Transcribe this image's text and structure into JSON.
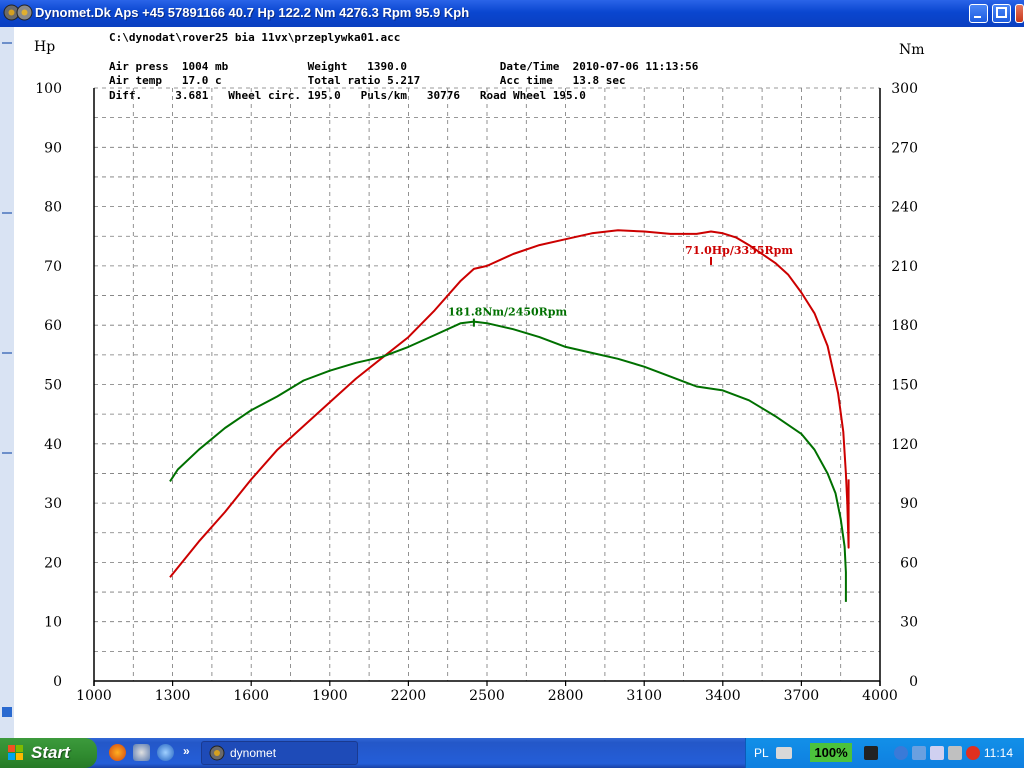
{
  "window": {
    "title": "Dynomet.Dk Aps +45 57891166  40.7 Hp 122.2 Nm 4276.3 Rpm 95.9 Kph"
  },
  "header": {
    "file_path": "C:\\dynodat\\rover25 bia 11vx\\przeplywka01.acc",
    "row1": "Air press  1004 mb            Weight   1390.0              Date/Time  2010-07-06 11:13:56",
    "row2": "Air temp   17.0 c             Total ratio 5.217            Acc time   13.8 sec",
    "row3": "Diff.     3.681   Wheel circ. 195.0   Puls/km   30776   Road Wheel 195.0"
  },
  "chart_data": {
    "type": "line",
    "x_label": "",
    "xlim": [
      1000,
      4000
    ],
    "x_ticks": [
      "1000",
      "1300",
      "1600",
      "1900",
      "2200",
      "2500",
      "2800",
      "3100",
      "3400",
      "3700",
      "4000"
    ],
    "y_left": {
      "label": "Hp",
      "range": [
        0,
        100
      ],
      "ticks": [
        "0",
        "10",
        "20",
        "30",
        "40",
        "50",
        "60",
        "70",
        "80",
        "90",
        "100"
      ]
    },
    "y_right": {
      "label": "Nm",
      "range": [
        0,
        300
      ],
      "ticks": [
        "0",
        "30",
        "60",
        "90",
        "120",
        "150",
        "180",
        "210",
        "240",
        "270",
        "300"
      ]
    },
    "grid": true,
    "series": [
      {
        "axis": "left",
        "color": "#cc0000",
        "unit": "Hp",
        "x": [
          1290,
          1400,
          1500,
          1600,
          1700,
          1800,
          1900,
          2000,
          2100,
          2200,
          2300,
          2400,
          2450,
          2500,
          2600,
          2700,
          2800,
          2900,
          3000,
          3100,
          3200,
          3300,
          3355,
          3400,
          3450,
          3500,
          3600,
          3650,
          3700,
          3750,
          3800,
          3840,
          3860,
          3870,
          3875,
          3880,
          3880,
          3880
        ],
        "values": [
          17.5,
          23.5,
          28.5,
          34,
          39,
          43,
          47,
          51,
          54.5,
          58,
          62.5,
          67.5,
          69.5,
          70,
          72,
          73.5,
          74.5,
          75.5,
          76,
          75.8,
          75.4,
          75.4,
          75.8,
          75.5,
          74.8,
          73.5,
          70.5,
          68.5,
          65.5,
          62,
          56.5,
          48.5,
          42,
          35,
          30,
          22.5,
          26,
          34
        ]
      },
      {
        "axis": "right",
        "color": "#007000",
        "unit": "Nm",
        "x": [
          1290,
          1320,
          1400,
          1500,
          1600,
          1700,
          1800,
          1900,
          2000,
          2100,
          2200,
          2300,
          2400,
          2450,
          2500,
          2600,
          2700,
          2800,
          2900,
          3000,
          3100,
          3200,
          3300,
          3400,
          3500,
          3600,
          3700,
          3750,
          3800,
          3830,
          3850,
          3865,
          3870,
          3870
        ],
        "values": [
          101,
          107,
          117,
          128,
          137,
          144,
          152,
          157,
          161,
          164,
          169,
          175,
          181,
          181.8,
          181,
          178,
          174,
          169,
          166,
          163,
          159,
          154,
          149,
          147,
          142,
          134,
          125,
          117,
          105,
          95,
          82,
          68,
          55,
          40
        ]
      }
    ],
    "annotations": [
      {
        "text": "71.0Hp/3355Rpm",
        "color": "#cc0000",
        "x": 3355,
        "y": 71.0,
        "axis": "left"
      },
      {
        "text": "181.8Nm/2450Rpm",
        "color": "#007000",
        "x": 2450,
        "y": 181.8,
        "axis": "right"
      }
    ]
  },
  "taskbar": {
    "start_label": "Start",
    "task_label": "dynomet",
    "language": "PL",
    "zoom": "100%",
    "clock": "11:14",
    "overflow_glyph": "»"
  }
}
